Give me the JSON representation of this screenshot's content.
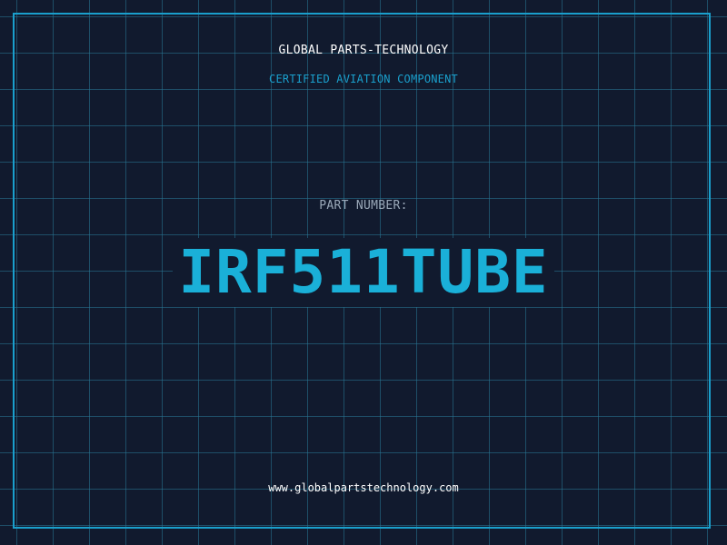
{
  "header": {
    "company": "GLOBAL PARTS-TECHNOLOGY",
    "subtitle": "CERTIFIED AVIATION COMPONENT"
  },
  "part": {
    "label": "PART NUMBER:",
    "number": "IRF511TUBE"
  },
  "footer": {
    "website": "www.globalpartstechnology.com"
  },
  "colors": {
    "background": "#111a2e",
    "grid": "#287896",
    "accent": "#1ab0d8",
    "frame": "#1a9fcc"
  }
}
